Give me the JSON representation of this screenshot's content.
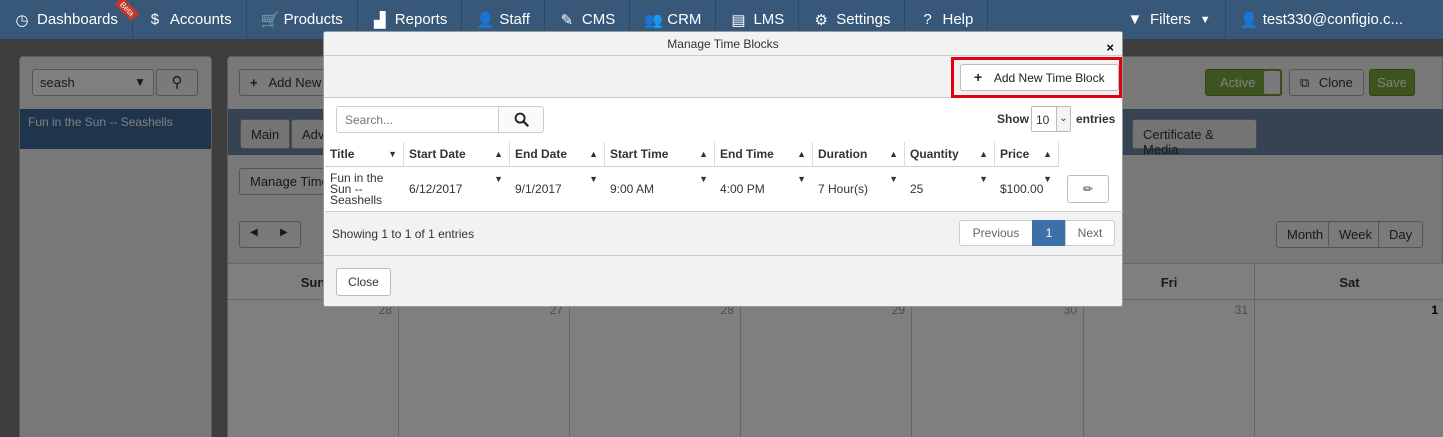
{
  "nav": {
    "items": [
      {
        "label": "Dashboards",
        "icon": "◷",
        "badge": "Beta"
      },
      {
        "label": "Accounts",
        "icon": "$"
      },
      {
        "label": "Products",
        "icon": "🛒"
      },
      {
        "label": "Reports",
        "icon": "▟"
      },
      {
        "label": "Staff",
        "icon": "👤"
      },
      {
        "label": "CMS",
        "icon": "✎"
      },
      {
        "label": "CRM",
        "icon": "👥"
      },
      {
        "label": "LMS",
        "icon": "▤"
      },
      {
        "label": "Settings",
        "icon": "⚙"
      },
      {
        "label": "Help",
        "icon": "?"
      }
    ],
    "filters_label": "Filters",
    "user_label": "test330@configio.c..."
  },
  "left_panel": {
    "search_value": "seash",
    "list_item": "Fun in the Sun -- Seashells"
  },
  "main_panel": {
    "add_new_label": "Add New",
    "active_label": "Active",
    "clone_label": "Clone",
    "save_label": "Save",
    "tabs": [
      "Main",
      "Adv"
    ],
    "certificate_tab": "Certificate & Media",
    "manage_time_label": "Manage Time",
    "view_buttons": [
      "Month",
      "Week",
      "Day"
    ],
    "calendar": {
      "days": [
        "Sun",
        "Fri",
        "Sat"
      ],
      "dates": [
        "28",
        "27",
        "28",
        "29",
        "30",
        "31",
        "1"
      ]
    }
  },
  "modal": {
    "title": "Manage Time Blocks",
    "close_x": "×",
    "add_button_label": "Add New Time Block",
    "search_placeholder": "Search...",
    "show_label": "Show",
    "show_value": "10",
    "entries_label": "entries",
    "columns": [
      "Title",
      "Start Date",
      "End Date",
      "Start Time",
      "End Time",
      "Duration",
      "Quantity",
      "Price"
    ],
    "rows": [
      {
        "title_lines": [
          "Fun in the",
          "Sun --",
          "Seashells"
        ],
        "start_date": "6/12/2017",
        "end_date": "9/1/2017",
        "start_time": "9:00 AM",
        "end_time": "4:00 PM",
        "duration": "7 Hour(s)",
        "quantity": "25",
        "price": "$100.00"
      }
    ],
    "showing_info": "Showing 1 to 1 of 1 entries",
    "pager": {
      "previous": "Previous",
      "current": "1",
      "next": "Next"
    },
    "close_label": "Close"
  },
  "colors": {
    "nav_bg": "#38587a",
    "highlight": "#e0000f",
    "active_page": "#3d6fa8",
    "success": "#7ba93e"
  }
}
